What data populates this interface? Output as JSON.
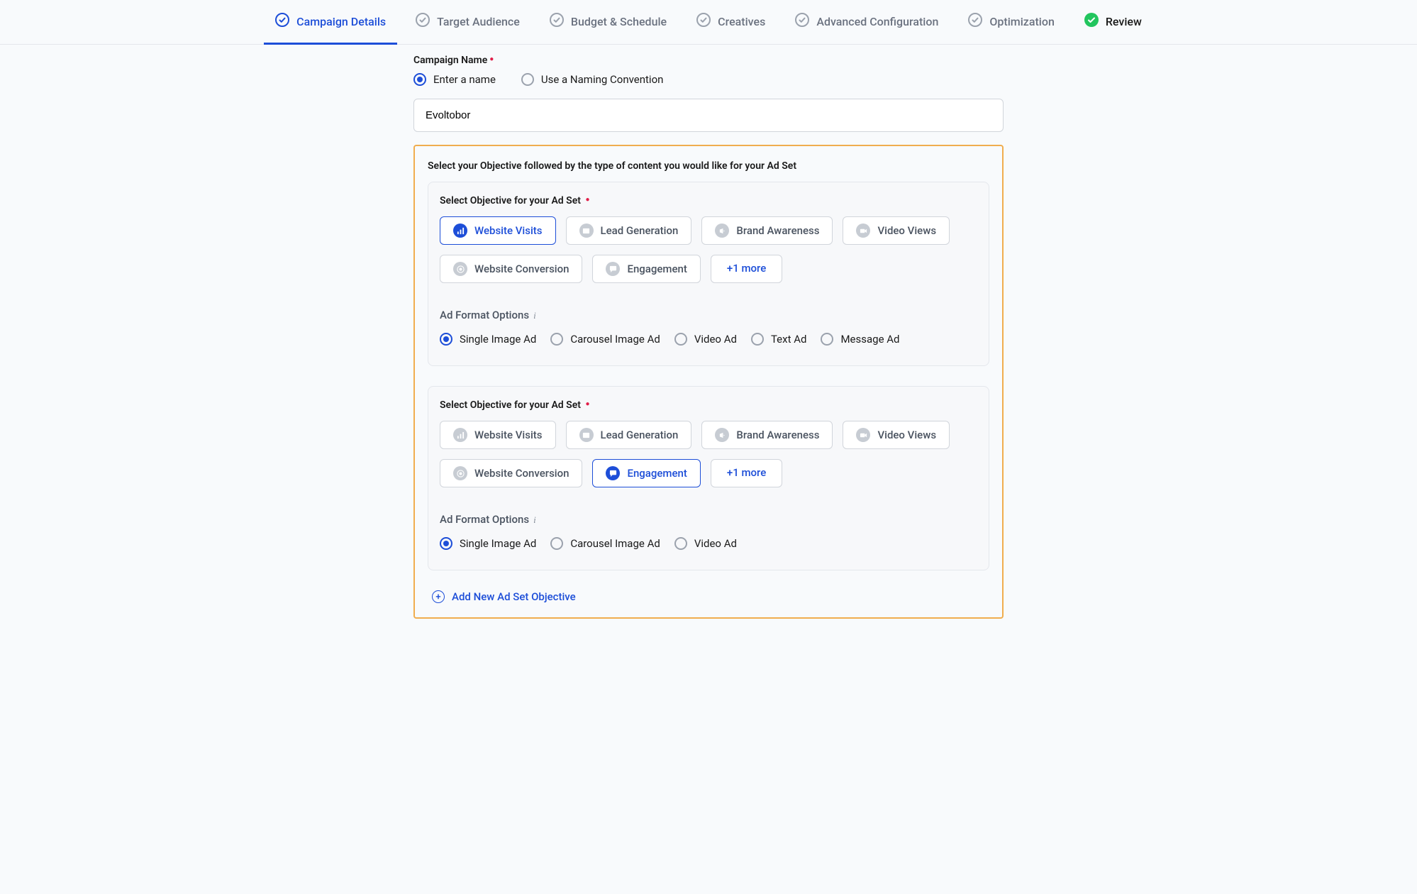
{
  "tabs": [
    {
      "label": "Campaign Details",
      "state": "active"
    },
    {
      "label": "Target Audience",
      "state": "pending"
    },
    {
      "label": "Budget & Schedule",
      "state": "pending"
    },
    {
      "label": "Creatives",
      "state": "pending"
    },
    {
      "label": "Advanced Configuration",
      "state": "pending"
    },
    {
      "label": "Optimization",
      "state": "pending"
    },
    {
      "label": "Review",
      "state": "complete"
    }
  ],
  "campaignName": {
    "label": "Campaign Name",
    "options": [
      "Enter a name",
      "Use a Naming Convention"
    ],
    "selectedOption": 0,
    "value": "Evoltobor"
  },
  "highlight": {
    "caption": "Select your Objective followed by the type of content you would like for your Ad Set",
    "objectiveLabel": "Select Objective for your Ad Set",
    "objectiveChips": [
      "Website Visits",
      "Lead Generation",
      "Brand Awareness",
      "Video Views",
      "Website Conversion",
      "Engagement"
    ],
    "moreLabel": "+1 more",
    "formatLabel": "Ad Format Options",
    "adsets": [
      {
        "selectedObjective": 0,
        "formats": [
          "Single Image Ad",
          "Carousel Image Ad",
          "Video Ad",
          "Text Ad",
          "Message Ad"
        ],
        "selectedFormat": 0
      },
      {
        "selectedObjective": 5,
        "formats": [
          "Single Image Ad",
          "Carousel Image Ad",
          "Video Ad"
        ],
        "selectedFormat": 0
      }
    ],
    "addLink": "Add New Ad Set Objective"
  }
}
